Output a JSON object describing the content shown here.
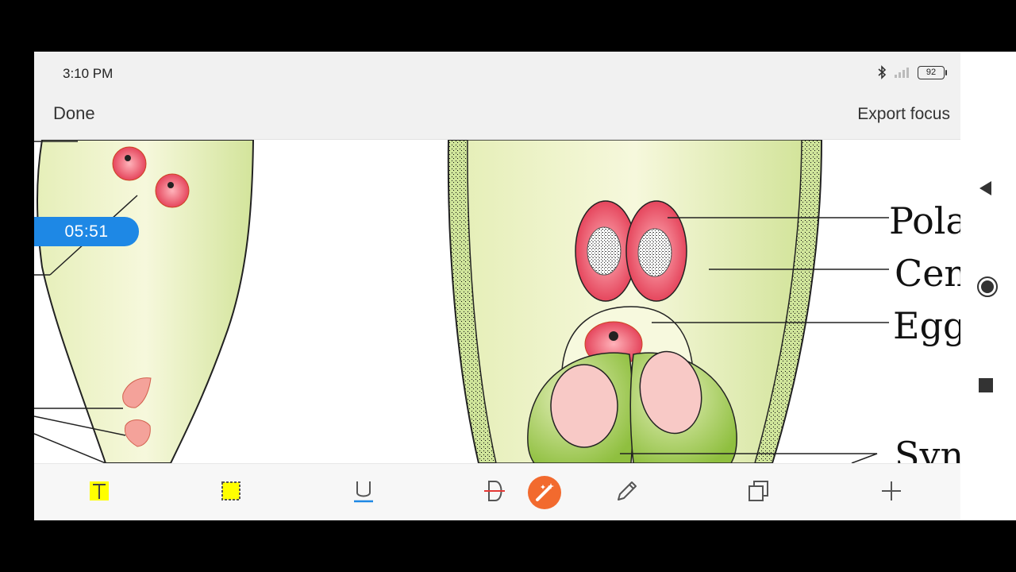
{
  "status_bar": {
    "time": "3:10 PM",
    "battery": "92",
    "icons": [
      "bluetooth-icon",
      "signal-icon",
      "battery-icon"
    ]
  },
  "top_bar": {
    "done_label": "Done",
    "export_label": "Export focus"
  },
  "timer": "05:51",
  "diagram": {
    "labels": [
      "Pola",
      "Cen",
      "Egg",
      "Syn"
    ]
  },
  "toolbar": {
    "tools": [
      "text-highlight-tool-icon",
      "area-highlight-tool-icon",
      "underline-tool-icon",
      "strikethrough-tool-icon",
      "magic-pen-tool-icon",
      "pencil-tool-icon",
      "copy-tool-icon",
      "add-tool-icon"
    ],
    "colors": {
      "highlight": "#ffff00",
      "accent": "#f26a2e",
      "underline": "#1e88e5",
      "strike": "#e53935"
    }
  },
  "nav": [
    "back-icon",
    "home-icon",
    "recents-icon"
  ]
}
